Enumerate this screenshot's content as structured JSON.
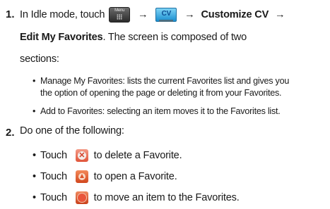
{
  "step1": {
    "number": "1.",
    "line1_prefix": "In Idle mode, touch",
    "menu_icon_label": "Menu",
    "arrow": "→",
    "customize_cv": "Customize CV",
    "edit_my_favorites": "Edit My Favorites",
    "line2_rest": ". The screen is composed of two",
    "line3": "sections:",
    "cv_icon_label": "CV",
    "bullets": [
      {
        "line1": "Manage My Favorites: lists the current Favorites list and gives you",
        "line2": "the option of opening the page or deleting it from your Favorites."
      },
      {
        "line1": "Add to Favorites: selecting an item moves it to the Favorites list."
      }
    ]
  },
  "step2": {
    "number": "2.",
    "intro": "Do one of the following:",
    "touch_word": "Touch",
    "actions": [
      {
        "icon": "delete-favorite-icon",
        "text": "to delete a Favorite."
      },
      {
        "icon": "open-favorite-icon",
        "text": "to open a Favorite."
      },
      {
        "icon": "add-favorite-icon",
        "text": "to move an item to the Favorites."
      }
    ]
  },
  "bullet_char": "•"
}
